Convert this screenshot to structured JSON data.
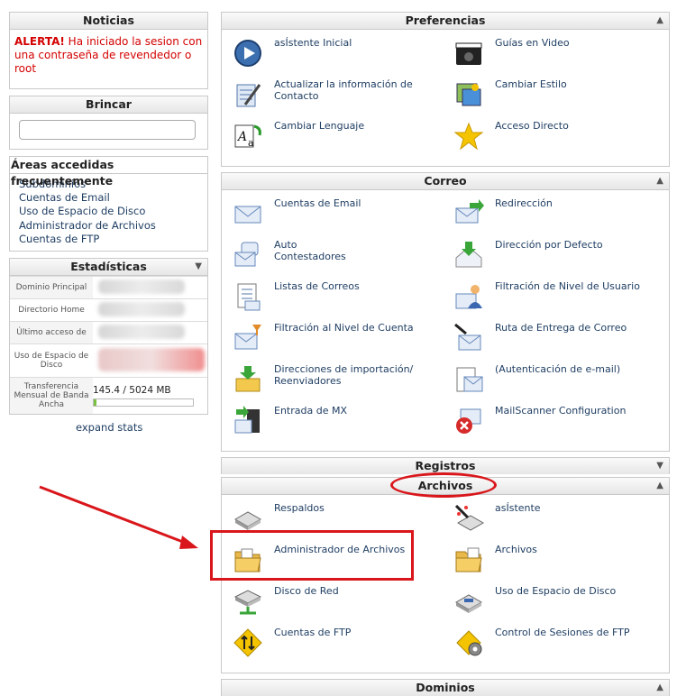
{
  "noticias": {
    "title": "Noticias",
    "alert_label": "ALERTA!",
    "alert_text": " Ha iniciado la sesion con una contraseña de revendedor o root"
  },
  "brincar": {
    "title": "Brincar",
    "search_value": ""
  },
  "frecuentes": {
    "title": "Áreas accedidas frecuentemente",
    "items": [
      "Subdominios",
      "Cuentas de Email",
      "Uso de Espacio de Disco",
      "Administrador de Archivos",
      "Cuentas de FTP"
    ]
  },
  "estadisticas": {
    "title": "Estadísticas",
    "rows": [
      {
        "label": "Dominio Principal"
      },
      {
        "label": "Directorio Home"
      },
      {
        "label": "Último acceso de"
      },
      {
        "label": "Uso de Espacio de Disco"
      },
      {
        "label": "Transferencia Mensual de Banda Ancha",
        "value": "145.4 / 5024 MB",
        "fraction": 0.029
      }
    ],
    "expand_label": "expand stats"
  },
  "preferencias": {
    "title": "Preferencias",
    "items": [
      "asÍstente Inicial",
      "Guías en Video",
      "Actualizar la información de Contacto",
      "Cambiar Estilo",
      "Cambiar Lenguaje",
      "Acceso Directo"
    ]
  },
  "correo": {
    "title": "Correo",
    "items": [
      "Cuentas de Email",
      "Redirección",
      "Auto\nContestadores",
      "Dirección por Defecto",
      "Listas de Correos",
      "Filtración de Nivel de Usuario",
      "Filtración al Nivel de Cuenta",
      "Ruta de Entrega de Correo",
      "Direcciones de importación/ Reenviadores",
      "(Autenticación de e-mail)",
      "Entrada de MX",
      "MailScanner Configuration"
    ]
  },
  "registros": {
    "title": "Registros"
  },
  "archivos": {
    "title": "Archivos",
    "items": [
      "Respaldos",
      "asÍstente",
      "Administrador de Archivos",
      "Archivos",
      "Disco de Red",
      "Uso de Espacio de Disco",
      "Cuentas de FTP",
      "Control de Sesiones de FTP"
    ]
  },
  "dominios": {
    "title": "Dominios"
  },
  "colors": {
    "link": "#1f3e63",
    "alert": "#d40000",
    "annotation": "#d9161b",
    "bar": "#7ac142"
  }
}
